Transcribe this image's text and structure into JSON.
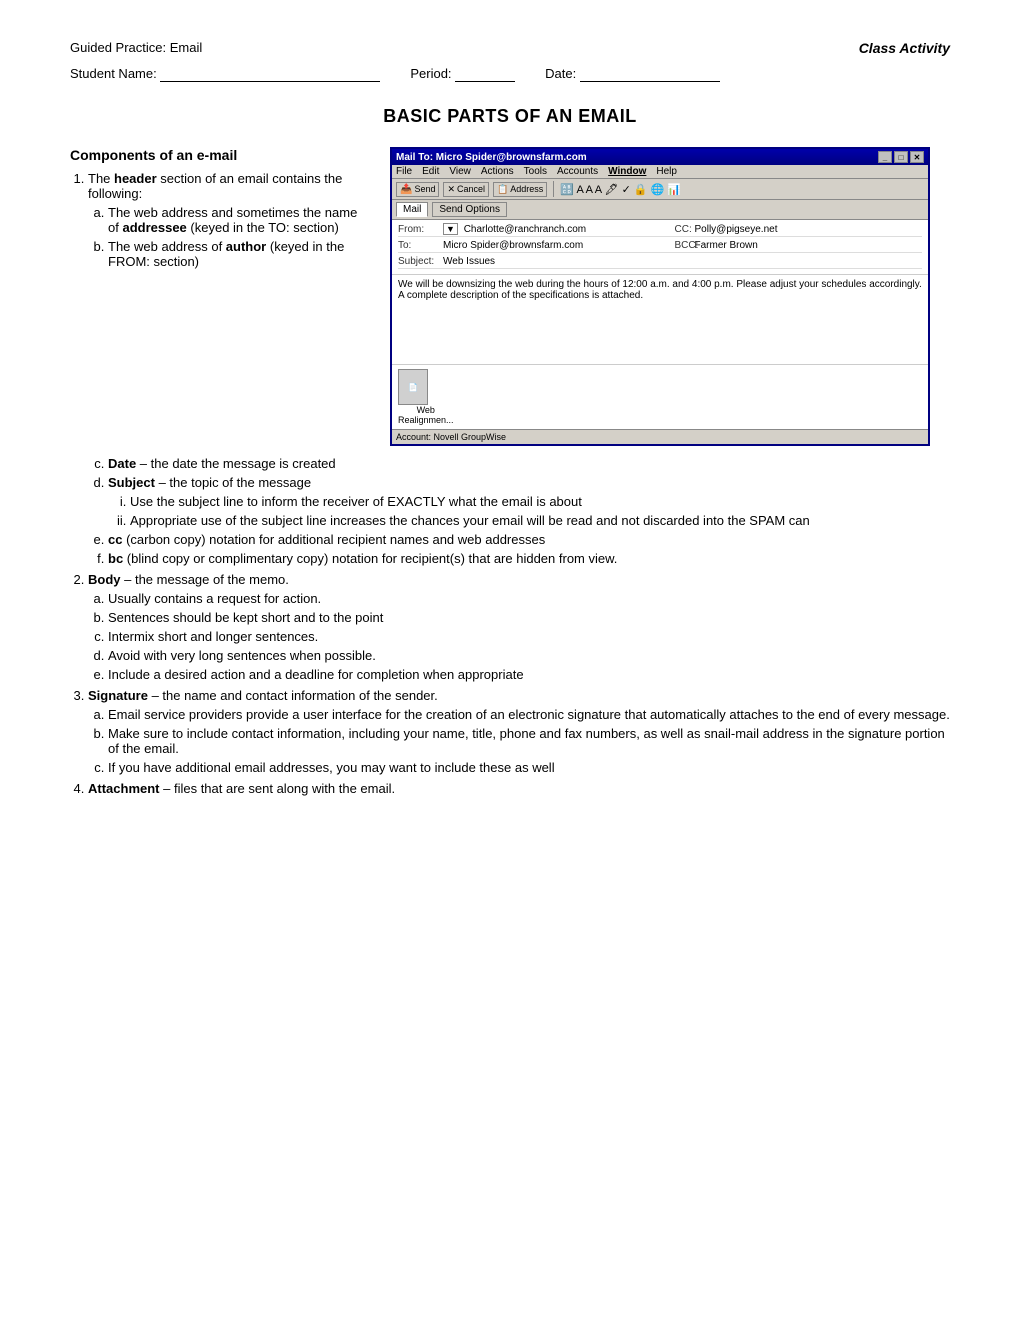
{
  "header": {
    "left": "Guided Practice:  Email",
    "right": "Class Activity"
  },
  "student_row": {
    "name_label": "Student Name:",
    "period_label": "Period:",
    "date_label": "Date:"
  },
  "page_title": "Basic Parts of an Email",
  "section_title": "Components of an e-mail",
  "email_window": {
    "titlebar": "Mail To: Micro Spider@brownsfarm.com",
    "menu_items": [
      "File",
      "Edit",
      "View",
      "Actions",
      "Tools",
      "Accounts",
      "Window",
      "Help"
    ],
    "toolbar_buttons": [
      "Send",
      "Cancel",
      "Address"
    ],
    "tabs": [
      "Mail",
      "Send Options"
    ],
    "fields": {
      "from_label": "From:",
      "from_value": "Charlotte@ranchranch.com",
      "cc_label": "CC:",
      "cc_value": "Polly@pigseye.net",
      "to_label": "To:",
      "to_value": "Micro Spider@brownsfarm.com",
      "bcc_label": "BCC:",
      "bcc_value": "Farmer Brown",
      "subject_label": "Subject:",
      "subject_value": "Web Issues"
    },
    "body_text": "We will be downsizing the web during the hours of 12:00 a.m. and 4:00 p.m. Please adjust your schedules accordingly.  A complete description of the specifications is attached.",
    "attachment_label": "Web\nRealignmen...",
    "statusbar": "Account: Novell GroupWise"
  },
  "list": {
    "item1_label": "header",
    "item1_text": " section of an email contains the following:",
    "item1_prefix": "The ",
    "sub_a_label": "addressee",
    "sub_a_text_1": "The web address and sometimes the name of ",
    "sub_a_text_2": " (keyed in the TO: section)",
    "sub_b_label": "author",
    "sub_b_text_1": "The web address of ",
    "sub_b_text_2": " (keyed in the FROM: section)",
    "sub_c_label": "Date",
    "sub_c_text": " – the date the message is created",
    "sub_d_label": "Subject",
    "sub_d_text": " – the topic of the message",
    "sub_d_i": "Use the subject line to inform the receiver of EXACTLY what the email is about",
    "sub_d_ii": "Appropriate use of the subject line increases the chances your email will be read and not discarded into the SPAM can",
    "sub_e_label": "cc",
    "sub_e_text": " (carbon copy) notation for additional recipient names and web addresses",
    "sub_f_label": "bc",
    "sub_f_text": " (blind copy or complimentary copy) notation for recipient(s) that are hidden from view.",
    "item2_label": "Body",
    "item2_text": " – the message of the memo.",
    "body_a": "Usually contains a request for action.",
    "body_b": "Sentences should be kept short and to the point",
    "body_c": "Intermix short and longer sentences.",
    "body_d": "Avoid with very long sentences when possible.",
    "body_e": "Include a desired action and a deadline for completion when appropriate",
    "item3_label": "Signature",
    "item3_text": " – the name and contact information of the sender.",
    "sig_a": "Email service providers provide a user interface for the creation of an electronic signature that automatically attaches to the end of every message.",
    "sig_b": "Make sure to include contact information, including your name, title, phone and fax numbers, as well as snail-mail address in the signature portion of the email.",
    "sig_c": "If you have additional email addresses, you may want to include these as well",
    "item4_label": "Attachment",
    "item4_text": " – files that are sent along with the email."
  }
}
